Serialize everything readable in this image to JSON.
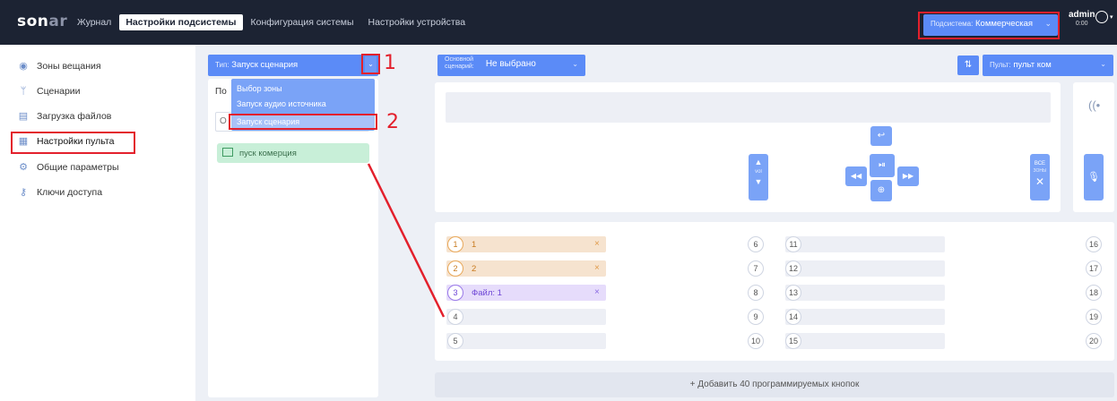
{
  "topbar": {
    "logo_main": "son",
    "logo_accent": "ar",
    "nav": [
      "Журнал",
      "Настройки подсистемы",
      "Конфигурация системы",
      "Настройки устройства"
    ],
    "subsystem_label": "Подсистема:",
    "subsystem_value": "Коммерческая",
    "user": "admin",
    "time": "0:00"
  },
  "sidebar": {
    "items": [
      {
        "label": "Зоны вещания",
        "icon": "broadcast-icon"
      },
      {
        "label": "Сценарии",
        "icon": "scenario-icon"
      },
      {
        "label": "Загрузка файлов",
        "icon": "upload-icon"
      },
      {
        "label": "Настройки пульта",
        "icon": "console-icon"
      },
      {
        "label": "Общие параметры",
        "icon": "settings-icon"
      },
      {
        "label": "Ключи доступа",
        "icon": "key-icon"
      }
    ]
  },
  "left_panel": {
    "type_label": "Тип:",
    "type_value": "Запуск сценария",
    "partial_label": "По",
    "search_partial": "О",
    "dropdown_options": [
      "Выбор зоны",
      "Запуск аудио источника",
      "Запуск сценария"
    ],
    "scenario_item": "пуск комерция"
  },
  "main": {
    "main_scenario_label_1": "Основной",
    "main_scenario_label_2": "сценарий:",
    "main_scenario_value": "Не выбрано",
    "pult_label": "Пульт:",
    "pult_value": "пульт ком",
    "vol_label": "vol",
    "all_label": "ВСЕ",
    "zones_label": "ЗОНЫ",
    "add_buttons": "+ Добавить 40 программируемых кнопок"
  },
  "grid": {
    "slots": [
      {
        "n": "1",
        "label": "1",
        "kind": "zone"
      },
      {
        "n": "2",
        "label": "2",
        "kind": "zone"
      },
      {
        "n": "3",
        "label": "Файл: 1",
        "kind": "file"
      },
      {
        "n": "4",
        "label": "",
        "kind": "empty"
      },
      {
        "n": "5",
        "label": "",
        "kind": "empty"
      }
    ],
    "col2": [
      "6",
      "7",
      "8",
      "9",
      "10"
    ],
    "col3": [
      "11",
      "12",
      "13",
      "14",
      "15"
    ],
    "col4": [
      "16",
      "17",
      "18",
      "19",
      "20"
    ],
    "remove_symbol": "×"
  },
  "annotations": [
    "1",
    "2"
  ],
  "colors": {
    "topbar": "#1c2333",
    "accent": "#5b8bf7",
    "annotation": "#e3202c",
    "zone_slot": "#f6e3cf",
    "file_slot": "#e6dcfb",
    "scenario_item": "#c8efd8"
  }
}
